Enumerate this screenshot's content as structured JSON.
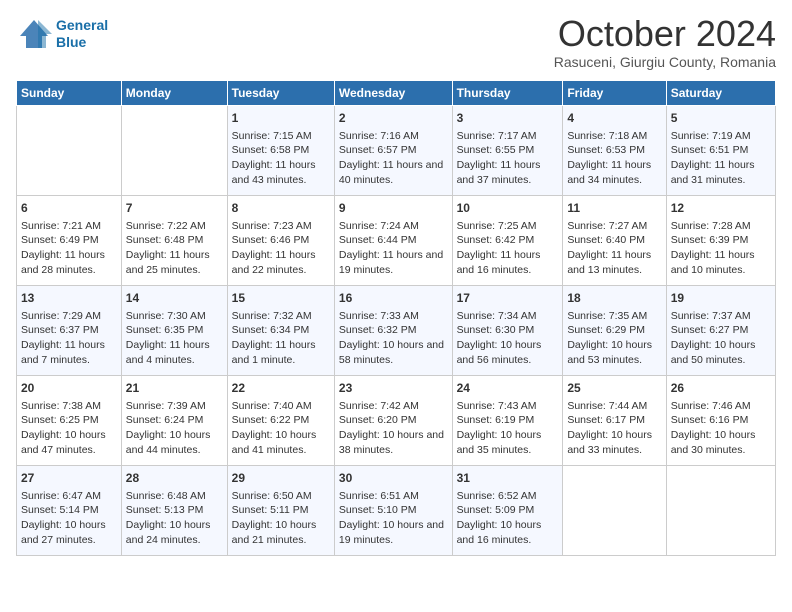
{
  "header": {
    "logo_line1": "General",
    "logo_line2": "Blue",
    "month": "October 2024",
    "location": "Rasuceni, Giurgiu County, Romania"
  },
  "weekdays": [
    "Sunday",
    "Monday",
    "Tuesday",
    "Wednesday",
    "Thursday",
    "Friday",
    "Saturday"
  ],
  "weeks": [
    [
      {
        "day": "",
        "info": ""
      },
      {
        "day": "",
        "info": ""
      },
      {
        "day": "1",
        "info": "Sunrise: 7:15 AM\nSunset: 6:58 PM\nDaylight: 11 hours and 43 minutes."
      },
      {
        "day": "2",
        "info": "Sunrise: 7:16 AM\nSunset: 6:57 PM\nDaylight: 11 hours and 40 minutes."
      },
      {
        "day": "3",
        "info": "Sunrise: 7:17 AM\nSunset: 6:55 PM\nDaylight: 11 hours and 37 minutes."
      },
      {
        "day": "4",
        "info": "Sunrise: 7:18 AM\nSunset: 6:53 PM\nDaylight: 11 hours and 34 minutes."
      },
      {
        "day": "5",
        "info": "Sunrise: 7:19 AM\nSunset: 6:51 PM\nDaylight: 11 hours and 31 minutes."
      }
    ],
    [
      {
        "day": "6",
        "info": "Sunrise: 7:21 AM\nSunset: 6:49 PM\nDaylight: 11 hours and 28 minutes."
      },
      {
        "day": "7",
        "info": "Sunrise: 7:22 AM\nSunset: 6:48 PM\nDaylight: 11 hours and 25 minutes."
      },
      {
        "day": "8",
        "info": "Sunrise: 7:23 AM\nSunset: 6:46 PM\nDaylight: 11 hours and 22 minutes."
      },
      {
        "day": "9",
        "info": "Sunrise: 7:24 AM\nSunset: 6:44 PM\nDaylight: 11 hours and 19 minutes."
      },
      {
        "day": "10",
        "info": "Sunrise: 7:25 AM\nSunset: 6:42 PM\nDaylight: 11 hours and 16 minutes."
      },
      {
        "day": "11",
        "info": "Sunrise: 7:27 AM\nSunset: 6:40 PM\nDaylight: 11 hours and 13 minutes."
      },
      {
        "day": "12",
        "info": "Sunrise: 7:28 AM\nSunset: 6:39 PM\nDaylight: 11 hours and 10 minutes."
      }
    ],
    [
      {
        "day": "13",
        "info": "Sunrise: 7:29 AM\nSunset: 6:37 PM\nDaylight: 11 hours and 7 minutes."
      },
      {
        "day": "14",
        "info": "Sunrise: 7:30 AM\nSunset: 6:35 PM\nDaylight: 11 hours and 4 minutes."
      },
      {
        "day": "15",
        "info": "Sunrise: 7:32 AM\nSunset: 6:34 PM\nDaylight: 11 hours and 1 minute."
      },
      {
        "day": "16",
        "info": "Sunrise: 7:33 AM\nSunset: 6:32 PM\nDaylight: 10 hours and 58 minutes."
      },
      {
        "day": "17",
        "info": "Sunrise: 7:34 AM\nSunset: 6:30 PM\nDaylight: 10 hours and 56 minutes."
      },
      {
        "day": "18",
        "info": "Sunrise: 7:35 AM\nSunset: 6:29 PM\nDaylight: 10 hours and 53 minutes."
      },
      {
        "day": "19",
        "info": "Sunrise: 7:37 AM\nSunset: 6:27 PM\nDaylight: 10 hours and 50 minutes."
      }
    ],
    [
      {
        "day": "20",
        "info": "Sunrise: 7:38 AM\nSunset: 6:25 PM\nDaylight: 10 hours and 47 minutes."
      },
      {
        "day": "21",
        "info": "Sunrise: 7:39 AM\nSunset: 6:24 PM\nDaylight: 10 hours and 44 minutes."
      },
      {
        "day": "22",
        "info": "Sunrise: 7:40 AM\nSunset: 6:22 PM\nDaylight: 10 hours and 41 minutes."
      },
      {
        "day": "23",
        "info": "Sunrise: 7:42 AM\nSunset: 6:20 PM\nDaylight: 10 hours and 38 minutes."
      },
      {
        "day": "24",
        "info": "Sunrise: 7:43 AM\nSunset: 6:19 PM\nDaylight: 10 hours and 35 minutes."
      },
      {
        "day": "25",
        "info": "Sunrise: 7:44 AM\nSunset: 6:17 PM\nDaylight: 10 hours and 33 minutes."
      },
      {
        "day": "26",
        "info": "Sunrise: 7:46 AM\nSunset: 6:16 PM\nDaylight: 10 hours and 30 minutes."
      }
    ],
    [
      {
        "day": "27",
        "info": "Sunrise: 6:47 AM\nSunset: 5:14 PM\nDaylight: 10 hours and 27 minutes."
      },
      {
        "day": "28",
        "info": "Sunrise: 6:48 AM\nSunset: 5:13 PM\nDaylight: 10 hours and 24 minutes."
      },
      {
        "day": "29",
        "info": "Sunrise: 6:50 AM\nSunset: 5:11 PM\nDaylight: 10 hours and 21 minutes."
      },
      {
        "day": "30",
        "info": "Sunrise: 6:51 AM\nSunset: 5:10 PM\nDaylight: 10 hours and 19 minutes."
      },
      {
        "day": "31",
        "info": "Sunrise: 6:52 AM\nSunset: 5:09 PM\nDaylight: 10 hours and 16 minutes."
      },
      {
        "day": "",
        "info": ""
      },
      {
        "day": "",
        "info": ""
      }
    ]
  ]
}
